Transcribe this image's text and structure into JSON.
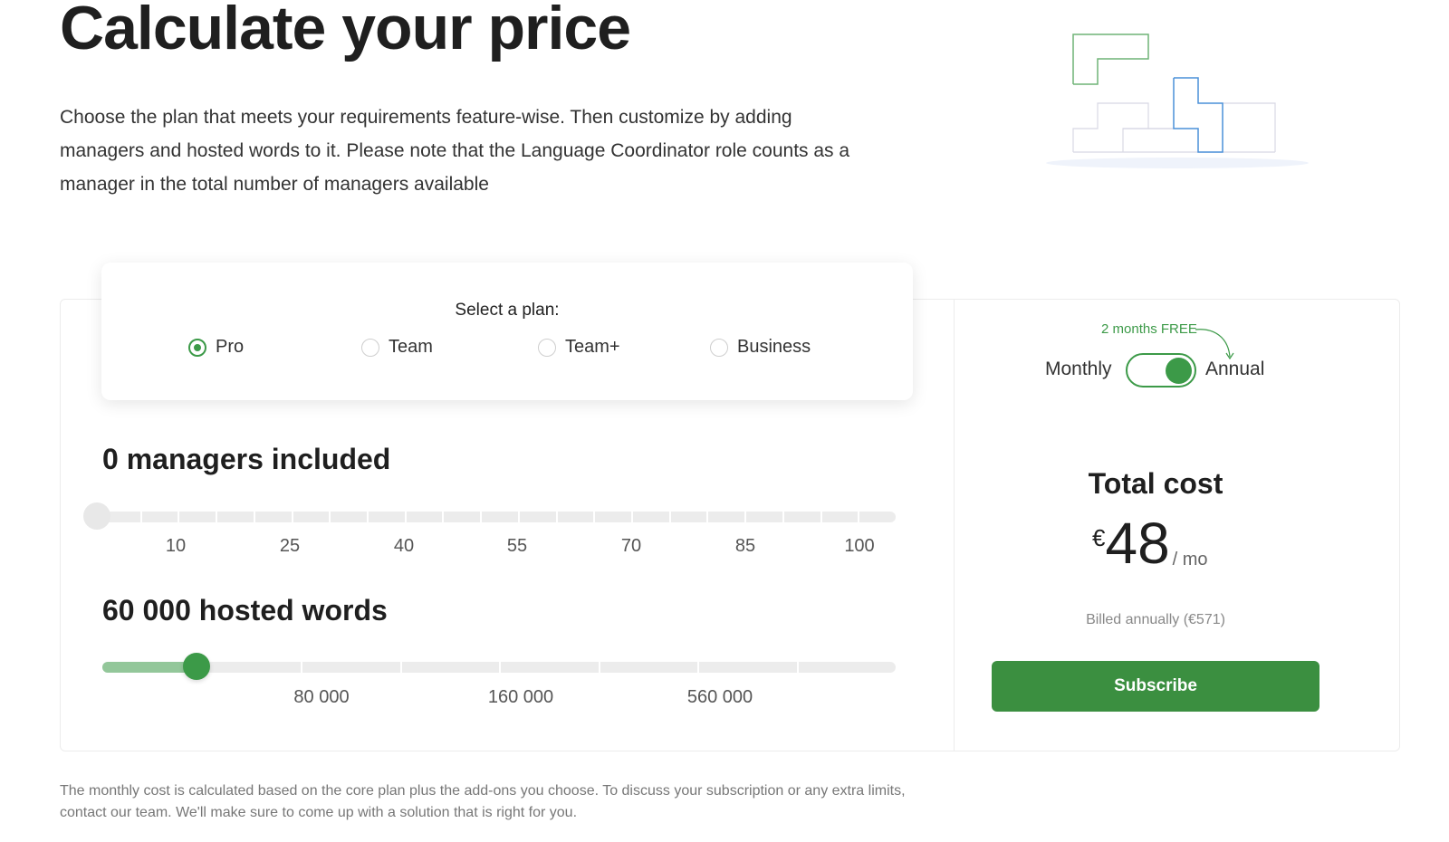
{
  "header": {
    "title": "Calculate your price",
    "description": "Choose the plan that meets your requirements feature-wise. Then customize by adding managers and hosted words to it. Please note that the Language Coordinator role counts as a manager in the total number of managers available"
  },
  "plan_selector": {
    "title": "Select a plan:",
    "options": [
      {
        "label": "Pro",
        "selected": true
      },
      {
        "label": "Team",
        "selected": false
      },
      {
        "label": "Team+",
        "selected": false
      },
      {
        "label": "Business",
        "selected": false
      }
    ]
  },
  "managers": {
    "heading": "0 managers included",
    "value": 0,
    "ticks": [
      "10",
      "25",
      "40",
      "55",
      "70",
      "85",
      "100"
    ]
  },
  "words": {
    "heading": "60 000 hosted words",
    "value": 60000,
    "ticks": [
      "80 000",
      "160 000",
      "560 000"
    ]
  },
  "billing": {
    "free_note": "2 months FREE",
    "monthly_label": "Monthly",
    "annual_label": "Annual",
    "annual_selected": true
  },
  "total": {
    "heading": "Total cost",
    "currency": "€",
    "amount": "48",
    "period": "/ mo",
    "billed_note": "Billed annually (€571)",
    "subscribe_label": "Subscribe"
  },
  "footnote": "The monthly cost is calculated based on the core plan plus the add-ons you choose. To discuss your subscription or any extra limits, contact our team. We'll make sure to come up with a solution that is right for you.",
  "colors": {
    "accent": "#3c9a48",
    "button": "#3b8f40",
    "fill": "#93c79a",
    "illustration_green": "#5aa662",
    "illustration_blue": "#4a90d9"
  }
}
